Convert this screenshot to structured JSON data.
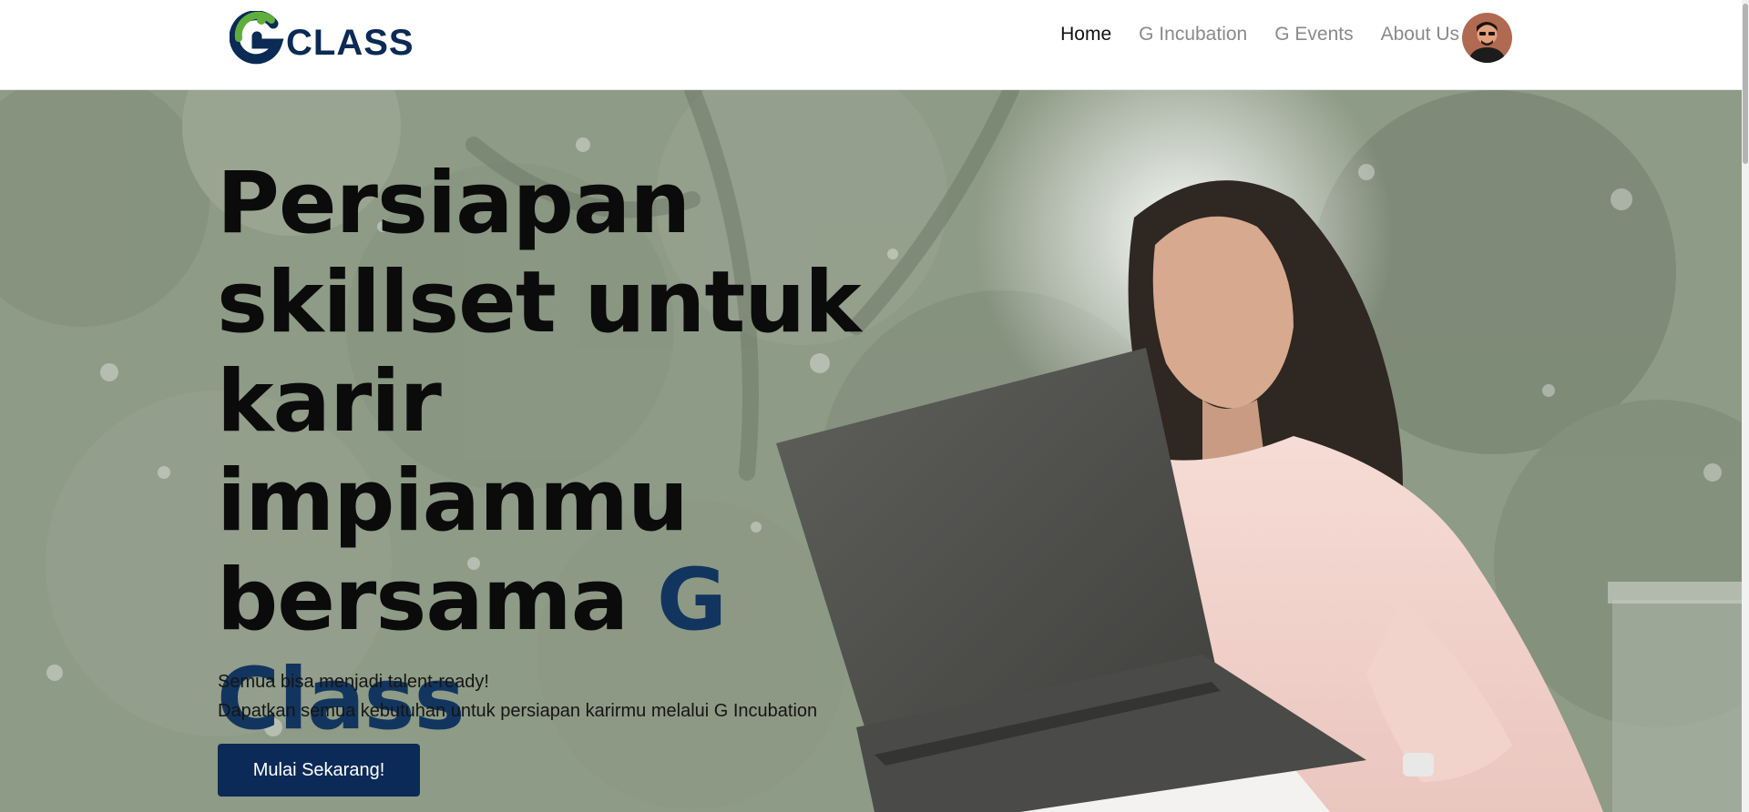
{
  "logo": {
    "text": "CLASS"
  },
  "nav": {
    "items": [
      {
        "label": "Home",
        "active": true
      },
      {
        "label": "G Incubation",
        "active": false
      },
      {
        "label": "G Events",
        "active": false
      },
      {
        "label": "About Us",
        "active": false
      }
    ]
  },
  "hero": {
    "headline_main": "Persiapan skillset untuk karir impianmu bersama ",
    "headline_accent": "G Class",
    "subtitle_line1": "Semua bisa menjadi talent-ready!",
    "subtitle_line2": "Dapatkan semua kebutuhan untuk persiapan karirmu melalui G Incubation",
    "cta_label": "Mulai Sekarang!"
  },
  "colors": {
    "brand_navy": "#0c2a57",
    "brand_green": "#5fae3c",
    "accent_text": "#12355f",
    "hero_tint": "#8f9c88"
  },
  "icons": [
    "g-class-logo-icon",
    "user-avatar"
  ]
}
